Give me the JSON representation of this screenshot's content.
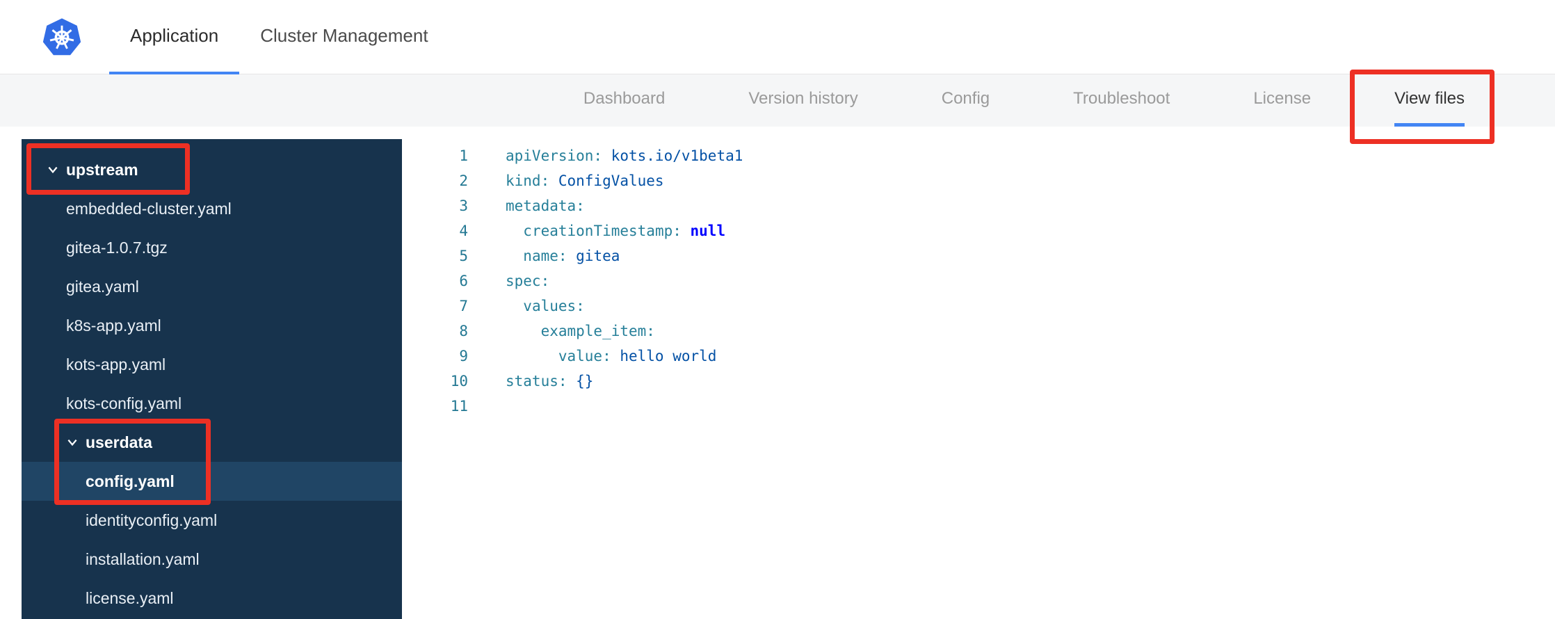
{
  "colors": {
    "accent_blue": "#4285f4",
    "annotation_red": "#ed3024",
    "sidebar_bg": "#17334d"
  },
  "header": {
    "logo": "kubernetes-logo",
    "tabs": [
      {
        "label": "Application",
        "active": true
      },
      {
        "label": "Cluster Management",
        "active": false
      }
    ]
  },
  "subnav": {
    "items": [
      {
        "label": "Dashboard",
        "active": false,
        "annotated": false
      },
      {
        "label": "Version history",
        "active": false,
        "annotated": false
      },
      {
        "label": "Config",
        "active": false,
        "annotated": false
      },
      {
        "label": "Troubleshoot",
        "active": false,
        "annotated": false
      },
      {
        "label": "License",
        "active": false,
        "annotated": false
      },
      {
        "label": "View files",
        "active": true,
        "annotated": true
      }
    ]
  },
  "file_tree": {
    "items": [
      {
        "type": "folder",
        "label": "upstream",
        "depth": 0,
        "expanded": true,
        "annotated": true,
        "selected": false
      },
      {
        "type": "file",
        "label": "embedded-cluster.yaml",
        "depth": 1,
        "selected": false
      },
      {
        "type": "file",
        "label": "gitea-1.0.7.tgz",
        "depth": 1,
        "selected": false
      },
      {
        "type": "file",
        "label": "gitea.yaml",
        "depth": 1,
        "selected": false
      },
      {
        "type": "file",
        "label": "k8s-app.yaml",
        "depth": 1,
        "selected": false
      },
      {
        "type": "file",
        "label": "kots-app.yaml",
        "depth": 1,
        "selected": false
      },
      {
        "type": "file",
        "label": "kots-config.yaml",
        "depth": 1,
        "selected": false
      },
      {
        "type": "folder",
        "label": "userdata",
        "depth": 1,
        "expanded": true,
        "annotated": true,
        "selected": false
      },
      {
        "type": "file",
        "label": "config.yaml",
        "depth": 2,
        "selected": true
      },
      {
        "type": "file",
        "label": "identityconfig.yaml",
        "depth": 2,
        "selected": false
      },
      {
        "type": "file",
        "label": "installation.yaml",
        "depth": 2,
        "selected": false
      },
      {
        "type": "file",
        "label": "license.yaml",
        "depth": 2,
        "selected": false
      }
    ]
  },
  "editor": {
    "language": "yaml",
    "lines": [
      {
        "number": 1,
        "tokens": [
          {
            "text": "apiVersion:",
            "type": "key"
          },
          {
            "text": " kots.io/v1beta1",
            "type": "value"
          }
        ]
      },
      {
        "number": 2,
        "tokens": [
          {
            "text": "kind:",
            "type": "key"
          },
          {
            "text": " ConfigValues",
            "type": "value"
          }
        ]
      },
      {
        "number": 3,
        "tokens": [
          {
            "text": "metadata:",
            "type": "key"
          }
        ]
      },
      {
        "number": 4,
        "tokens": [
          {
            "text": "  ",
            "type": "plain"
          },
          {
            "text": "creationTimestamp:",
            "type": "key"
          },
          {
            "text": " null",
            "type": "keyword"
          }
        ]
      },
      {
        "number": 5,
        "tokens": [
          {
            "text": "  ",
            "type": "plain"
          },
          {
            "text": "name:",
            "type": "key"
          },
          {
            "text": " gitea",
            "type": "value"
          }
        ]
      },
      {
        "number": 6,
        "tokens": [
          {
            "text": "spec:",
            "type": "key"
          }
        ]
      },
      {
        "number": 7,
        "tokens": [
          {
            "text": "  ",
            "type": "plain"
          },
          {
            "text": "values:",
            "type": "key"
          }
        ]
      },
      {
        "number": 8,
        "tokens": [
          {
            "text": "    ",
            "type": "plain"
          },
          {
            "text": "example_item:",
            "type": "key"
          }
        ]
      },
      {
        "number": 9,
        "tokens": [
          {
            "text": "      ",
            "type": "plain"
          },
          {
            "text": "value:",
            "type": "key"
          },
          {
            "text": " hello world",
            "type": "value"
          }
        ]
      },
      {
        "number": 10,
        "tokens": [
          {
            "text": "status:",
            "type": "key"
          },
          {
            "text": " {}",
            "type": "value"
          }
        ]
      },
      {
        "number": 11,
        "tokens": []
      }
    ]
  }
}
